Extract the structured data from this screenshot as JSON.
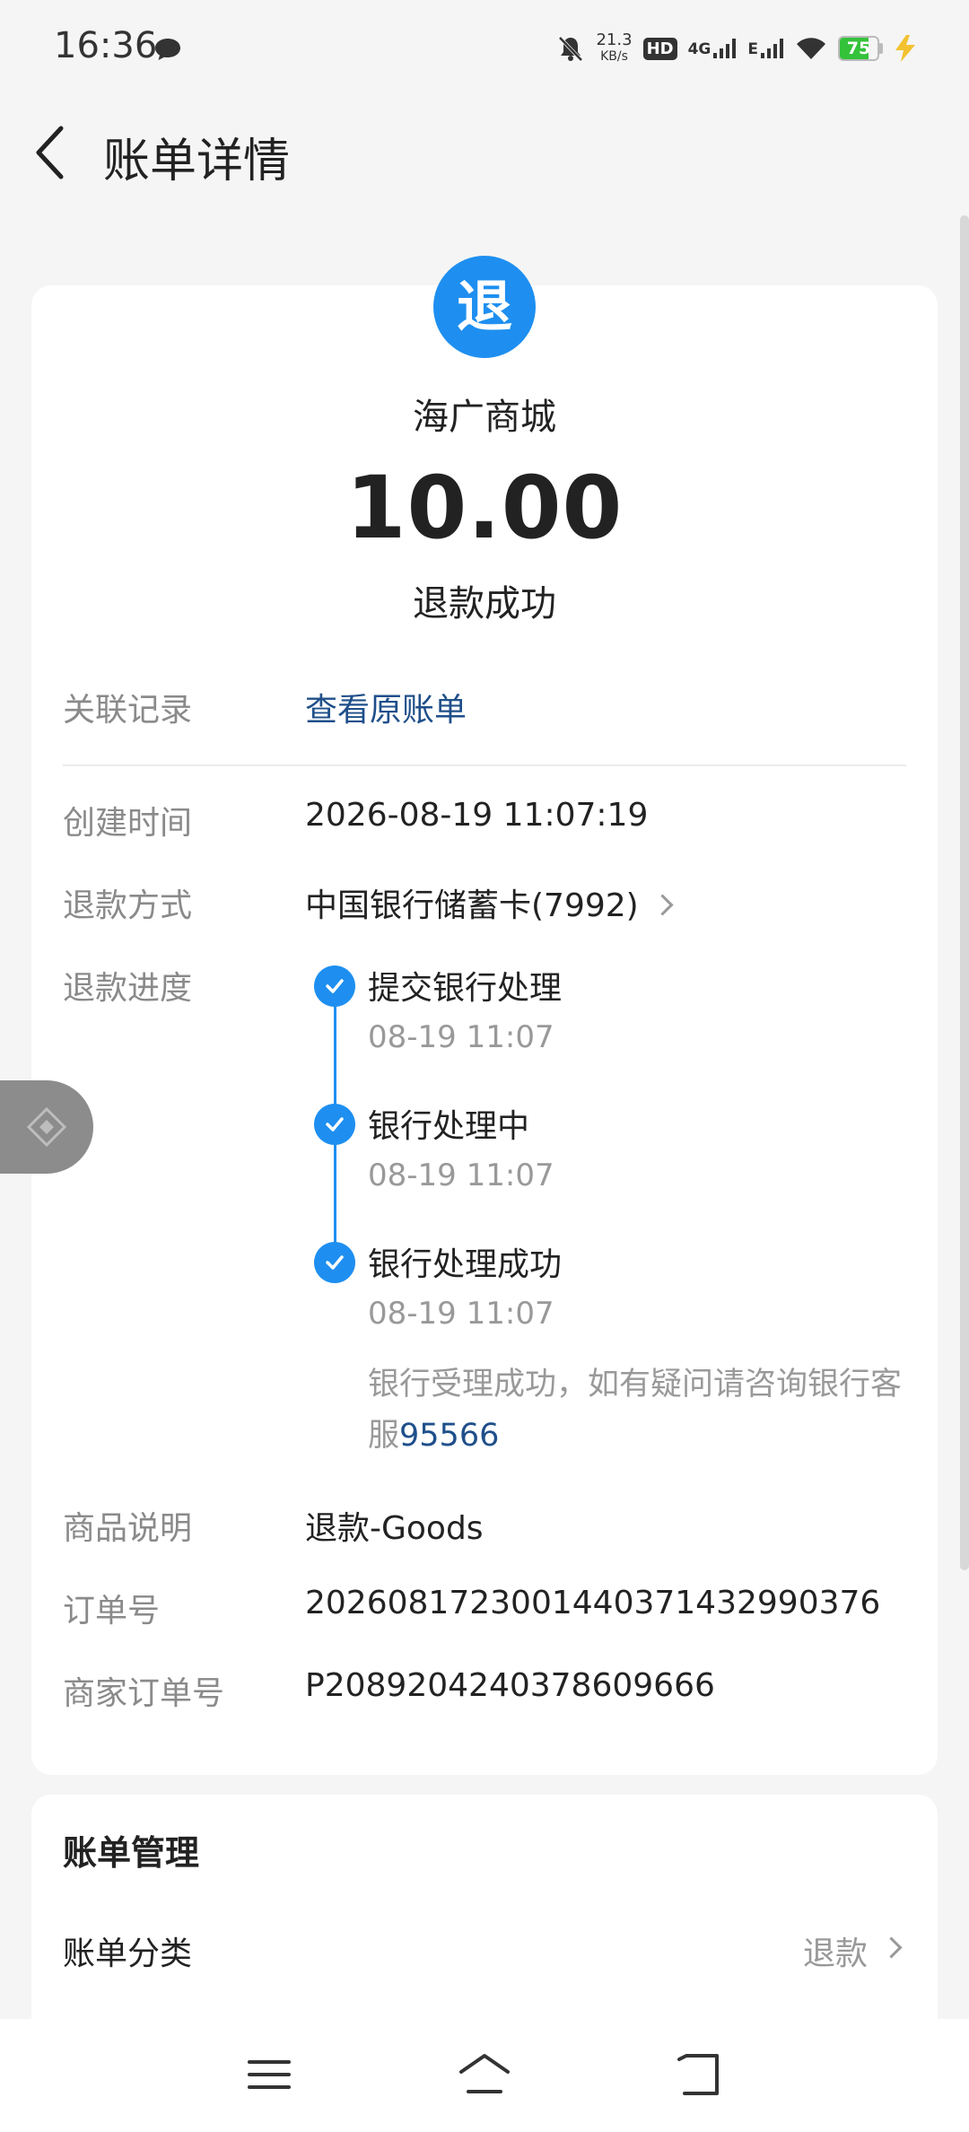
{
  "status_bar": {
    "time": "16:36",
    "net_speed_value": "21.3",
    "net_speed_unit": "KB/s",
    "hd_label": "HD",
    "net_4g": "4G",
    "net_e": "E",
    "battery_level": "75",
    "battery_fraction": 0.75
  },
  "header": {
    "title": "账单详情"
  },
  "summary": {
    "icon_char": "退",
    "merchant": "海广商城",
    "amount": "10.00",
    "status": "退款成功"
  },
  "details": {
    "related_label": "关联记录",
    "related_link": "查看原账单",
    "created_label": "创建时间",
    "created_value": "2026-08-19 11:07:19",
    "method_label": "退款方式",
    "method_value": "中国银行储蓄卡(7992)",
    "progress_label": "退款进度",
    "steps": [
      {
        "title": "提交银行处理",
        "time": "08-19 11:07"
      },
      {
        "title": "银行处理中",
        "time": "08-19 11:07"
      },
      {
        "title": "银行处理成功",
        "time": "08-19 11:07"
      }
    ],
    "note_text": "银行受理成功，如有疑问请咨询银行客服",
    "note_phone": "95566",
    "goods_label": "商品说明",
    "goods_value": "退款-Goods",
    "order_label": "订单号",
    "order_value": "2026081723001440371432990376",
    "merchant_order_label": "商家订单号",
    "merchant_order_value": "P2089204240378609666"
  },
  "management": {
    "title": "账单管理",
    "category_label": "账单分类",
    "category_value": "退款"
  },
  "colors": {
    "accent": "#1e8ff0",
    "link": "#1f4f8a",
    "background": "#f5f5f5"
  }
}
